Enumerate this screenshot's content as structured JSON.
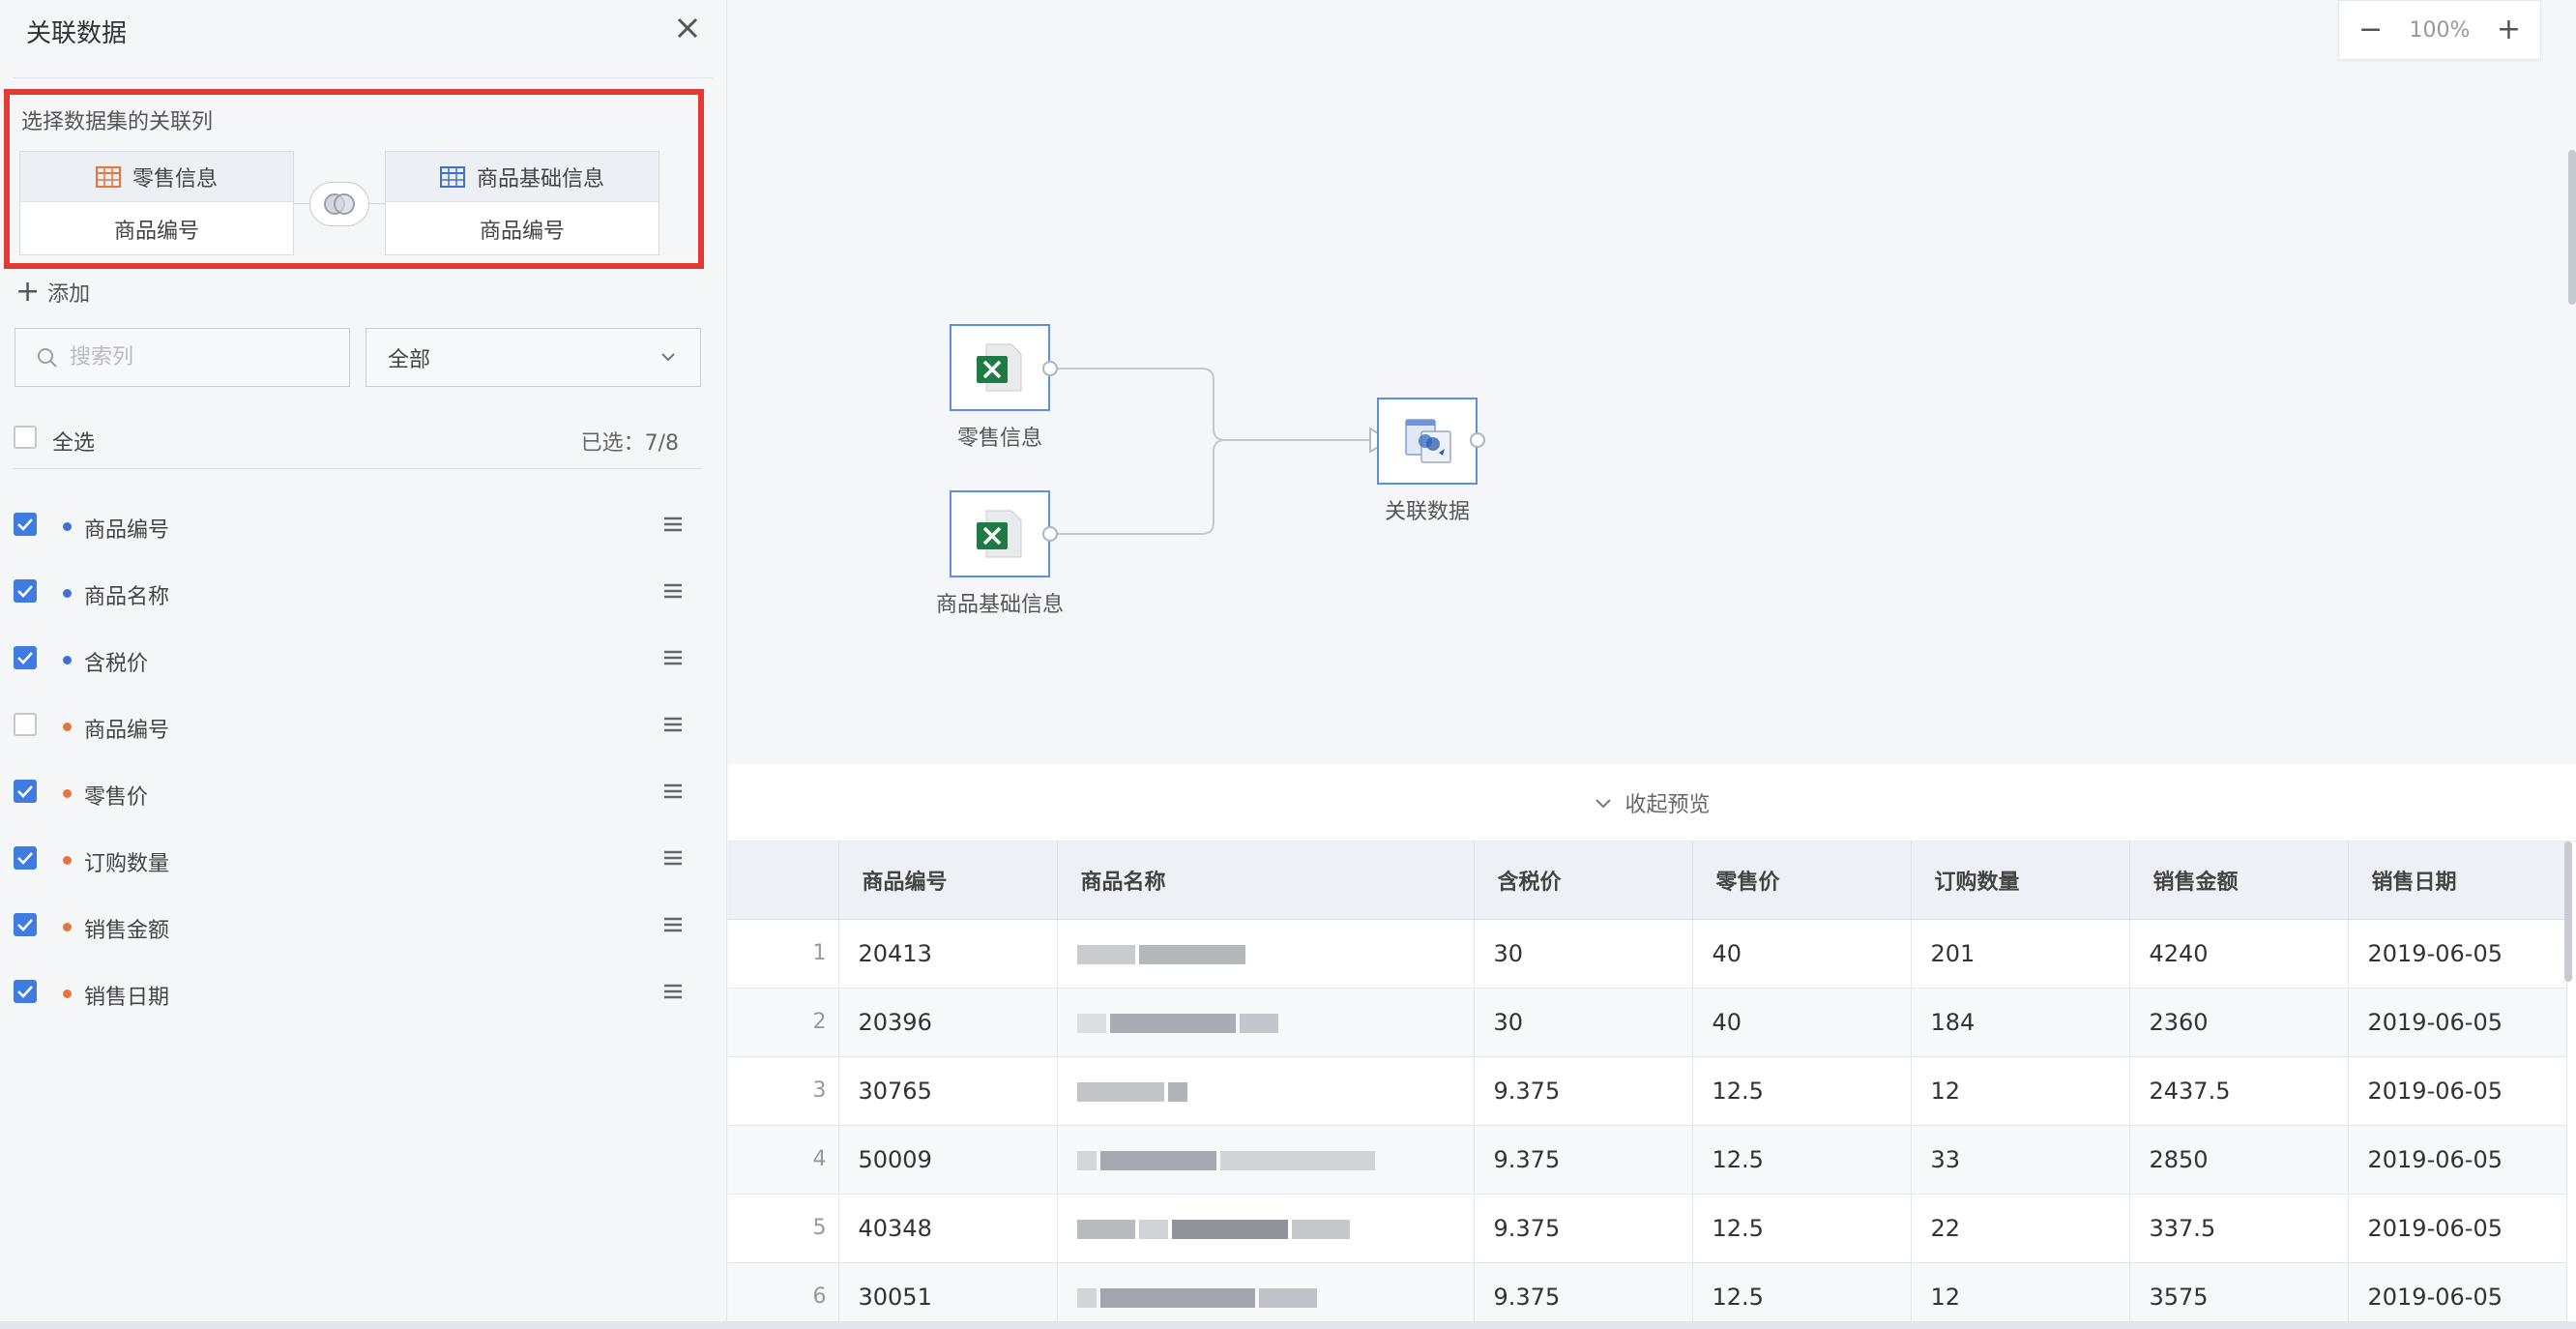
{
  "panel": {
    "title": "关联数据",
    "join": {
      "caption": "选择数据集的关联列",
      "left": {
        "name": "零售信息",
        "column": "商品编号",
        "icon": "table-icon-orange"
      },
      "right": {
        "name": "商品基础信息",
        "column": "商品编号",
        "icon": "table-icon-blue"
      },
      "join_type_icon": "join-type-icon"
    },
    "add_label": "添加",
    "search": {
      "placeholder": "搜索列",
      "value": ""
    },
    "filter": {
      "selected": "全部"
    },
    "select_all_label": "全选",
    "selected_count": "已选：7/8",
    "fields": [
      {
        "label": "商品编号",
        "checked": true,
        "source": "blue"
      },
      {
        "label": "商品名称",
        "checked": true,
        "source": "blue"
      },
      {
        "label": "含税价",
        "checked": true,
        "source": "blue"
      },
      {
        "label": "商品编号",
        "checked": false,
        "source": "orange"
      },
      {
        "label": "零售价",
        "checked": true,
        "source": "orange"
      },
      {
        "label": "订购数量",
        "checked": true,
        "source": "orange"
      },
      {
        "label": "销售金额",
        "checked": true,
        "source": "orange"
      },
      {
        "label": "销售日期",
        "checked": true,
        "source": "orange"
      }
    ]
  },
  "canvas": {
    "zoom": "100%",
    "nodes": [
      {
        "label": "零售信息",
        "icon": "excel-icon"
      },
      {
        "label": "商品基础信息",
        "icon": "excel-icon"
      },
      {
        "label": "关联数据",
        "icon": "join-dataset-icon"
      }
    ]
  },
  "preview": {
    "toggle_label": "收起预览",
    "columns": [
      "商品编号",
      "商品名称",
      "含税价",
      "零售价",
      "订购数量",
      "销售金额",
      "销售日期"
    ],
    "rows": [
      {
        "n": "1",
        "cells": [
          "20413",
          "",
          "30",
          "40",
          "201",
          "4240",
          "2019-06-05"
        ]
      },
      {
        "n": "2",
        "cells": [
          "20396",
          "",
          "30",
          "40",
          "184",
          "2360",
          "2019-06-05"
        ]
      },
      {
        "n": "3",
        "cells": [
          "30765",
          "",
          "9.375",
          "12.5",
          "12",
          "2437.5",
          "2019-06-05"
        ]
      },
      {
        "n": "4",
        "cells": [
          "50009",
          "",
          "9.375",
          "12.5",
          "33",
          "2850",
          "2019-06-05"
        ]
      },
      {
        "n": "5",
        "cells": [
          "40348",
          "",
          "9.375",
          "12.5",
          "22",
          "337.5",
          "2019-06-05"
        ]
      },
      {
        "n": "6",
        "cells": [
          "30051",
          "",
          "9.375",
          "12.5",
          "12",
          "3575",
          "2019-06-05"
        ]
      }
    ]
  },
  "colors": {
    "accent": "#3f7be0",
    "highlight_border": "#e03a32",
    "source_blue": "#3d6fd6",
    "source_orange": "#e8743b",
    "excel_green": "#1e7b45"
  }
}
